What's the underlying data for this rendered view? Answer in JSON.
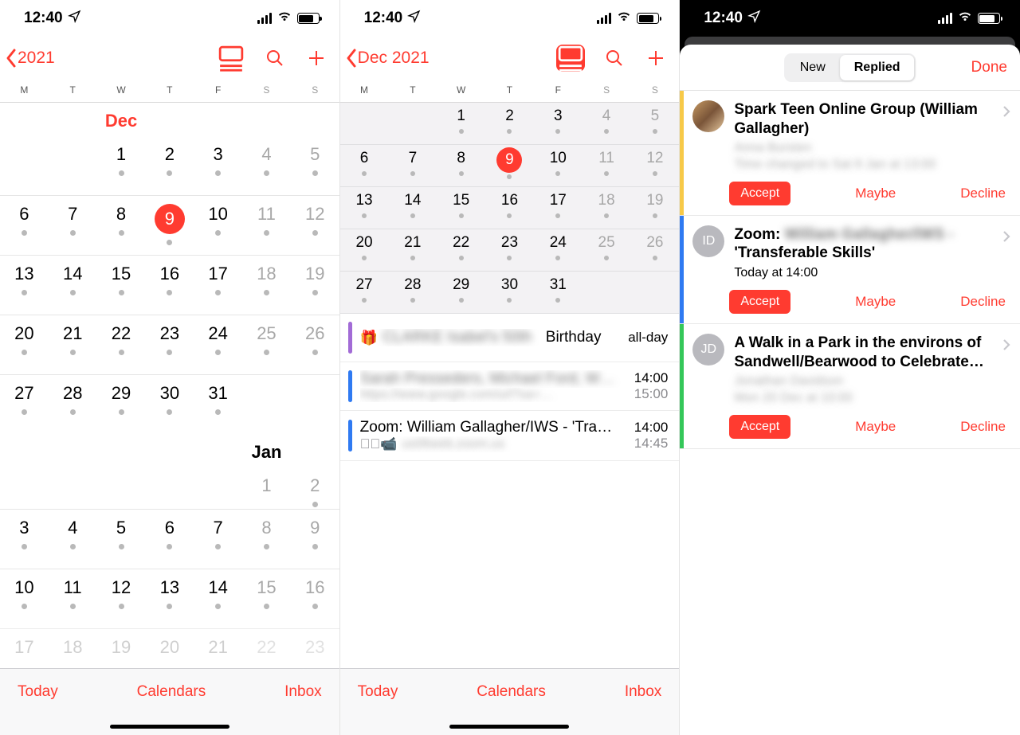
{
  "status": {
    "time": "12:40"
  },
  "pane1": {
    "back_label": "2021",
    "weekdays": [
      "M",
      "T",
      "W",
      "T",
      "F",
      "S",
      "S"
    ],
    "month1_label": "Dec",
    "month2_label": "Jan",
    "toolbar": {
      "today": "Today",
      "calendars": "Calendars",
      "inbox": "Inbox"
    }
  },
  "pane2": {
    "back_label": "Dec 2021",
    "weekdays": [
      "M",
      "T",
      "W",
      "T",
      "F",
      "S",
      "S"
    ],
    "events": [
      {
        "title_blur": "CLARKE Isabel's 50th",
        "title_tail": "Birthday",
        "time1": "all-day",
        "time2": "",
        "icon": "gift"
      },
      {
        "title_blur": "Sarah Presseders, Michael Ford, W…",
        "sub_blur": "https://www.google.com/url?sa=…",
        "time1": "14:00",
        "time2": "15:00"
      },
      {
        "title": "Zoom: William Gallagher/IWS - 'Tra…",
        "sub_blur": "us06web.zoom.us",
        "time1": "14:00",
        "time2": "14:45",
        "icon": "cam"
      }
    ],
    "toolbar": {
      "today": "Today",
      "calendars": "Calendars",
      "inbox": "Inbox"
    }
  },
  "pane3": {
    "seg_new": "New",
    "seg_replied": "Replied",
    "done": "Done",
    "invites": [
      {
        "stripe": "yellow",
        "initials": "",
        "avatar_img": true,
        "title": "Spark Teen Online Group (William Gallagher)",
        "sub_blur": "Anna Bursten",
        "detail_blur": "Time changed to Sat 8 Jan at 13:00",
        "time": ""
      },
      {
        "stripe": "blue",
        "initials": "ID",
        "title_pre": "Zoom: ",
        "title_blur": "William Gallagher/IWS -",
        "title_post": "'Transferable Skills'",
        "sub_blur": "",
        "time": "Today at 14:00"
      },
      {
        "stripe": "green",
        "initials": "JD",
        "title": "A Walk in a Park in the environs of Sandwell/Bearwood to Celebrate…",
        "sub_blur": "Jonathan Davidson",
        "detail_blur": "Mon 20 Dec at 10:00",
        "time": ""
      }
    ],
    "actions": {
      "accept": "Accept",
      "maybe": "Maybe",
      "decline": "Decline"
    }
  }
}
